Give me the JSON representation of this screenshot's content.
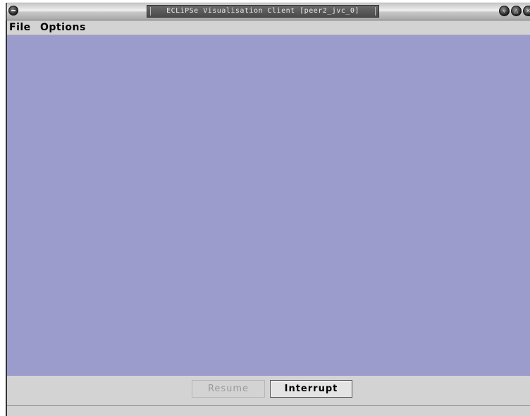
{
  "window": {
    "title": "ECLiPSe Visualisation Client [peer2_jvc_0]"
  },
  "menubar": {
    "items": [
      {
        "label": "File"
      },
      {
        "label": "Options"
      }
    ]
  },
  "buttons": {
    "resume_label": "Resume",
    "resume_enabled": false,
    "interrupt_label": "Interrupt",
    "interrupt_enabled": true
  },
  "status": {
    "text": ""
  },
  "colors": {
    "canvas_background": "#9c9ccc",
    "panel_background": "#d3d3d3",
    "disabled_text": "#9a9a9a"
  },
  "icons": {
    "window_menu": "window-menu-icon",
    "minimize": "minimize-icon",
    "maximize": "maximize-icon",
    "close": "close-icon"
  }
}
